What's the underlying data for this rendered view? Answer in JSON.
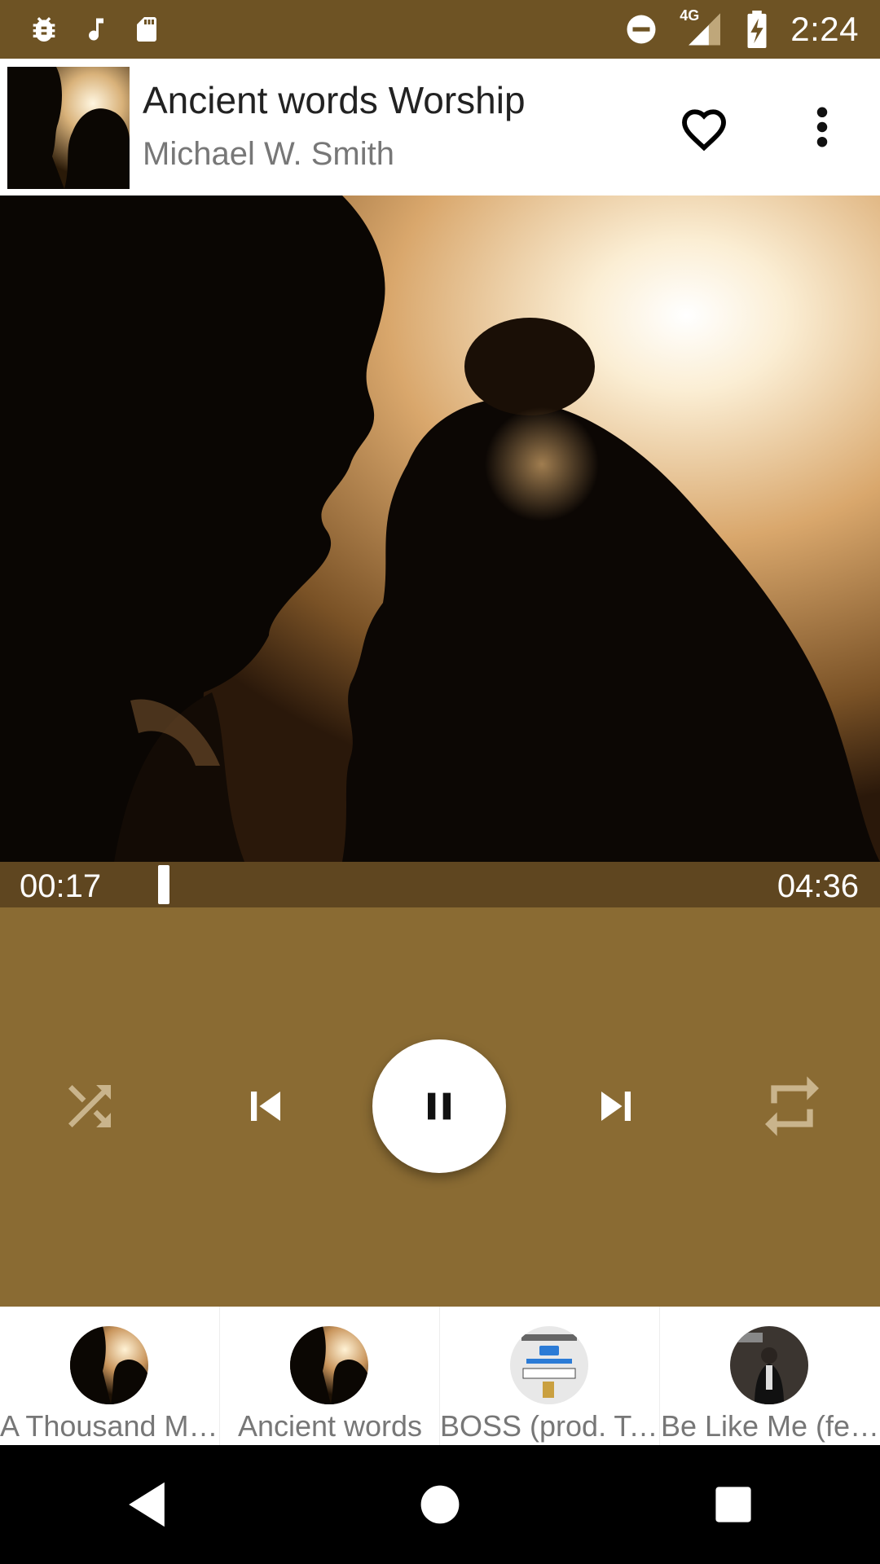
{
  "status_bar": {
    "time": "2:24",
    "network": "4G",
    "left_icons": [
      "bug-icon",
      "music-note-icon",
      "sd-card-icon"
    ],
    "right_icons": [
      "do-not-disturb-icon",
      "signal-icon",
      "battery-charging-icon"
    ]
  },
  "now_playing": {
    "title": "Ancient words Worship",
    "artist": "Michael W. Smith",
    "favorite_icon": "heart-outline-icon",
    "menu_icon": "more-vert-icon"
  },
  "progress": {
    "current_time": "00:17",
    "total_time": "04:36",
    "fraction": 0.062
  },
  "controls": {
    "shuffle_icon": "shuffle-icon",
    "previous_icon": "skip-previous-icon",
    "play_pause_icon": "pause-icon",
    "next_icon": "skip-next-icon",
    "repeat_icon": "repeat-icon"
  },
  "queue": [
    {
      "label": "A Thousand Mi…"
    },
    {
      "label": "Ancient words"
    },
    {
      "label": "BOSS (prod. Te…"
    },
    {
      "label": "Be Like Me (fe…"
    }
  ],
  "colors": {
    "status_bar": "#6E5324",
    "progress_bar": "#5F4620",
    "controls_bg": "#8A6B33",
    "accent_white": "#FFFFFF"
  },
  "nav": {
    "back_icon": "back-triangle-icon",
    "home_icon": "home-circle-icon",
    "recents_icon": "recents-square-icon"
  }
}
